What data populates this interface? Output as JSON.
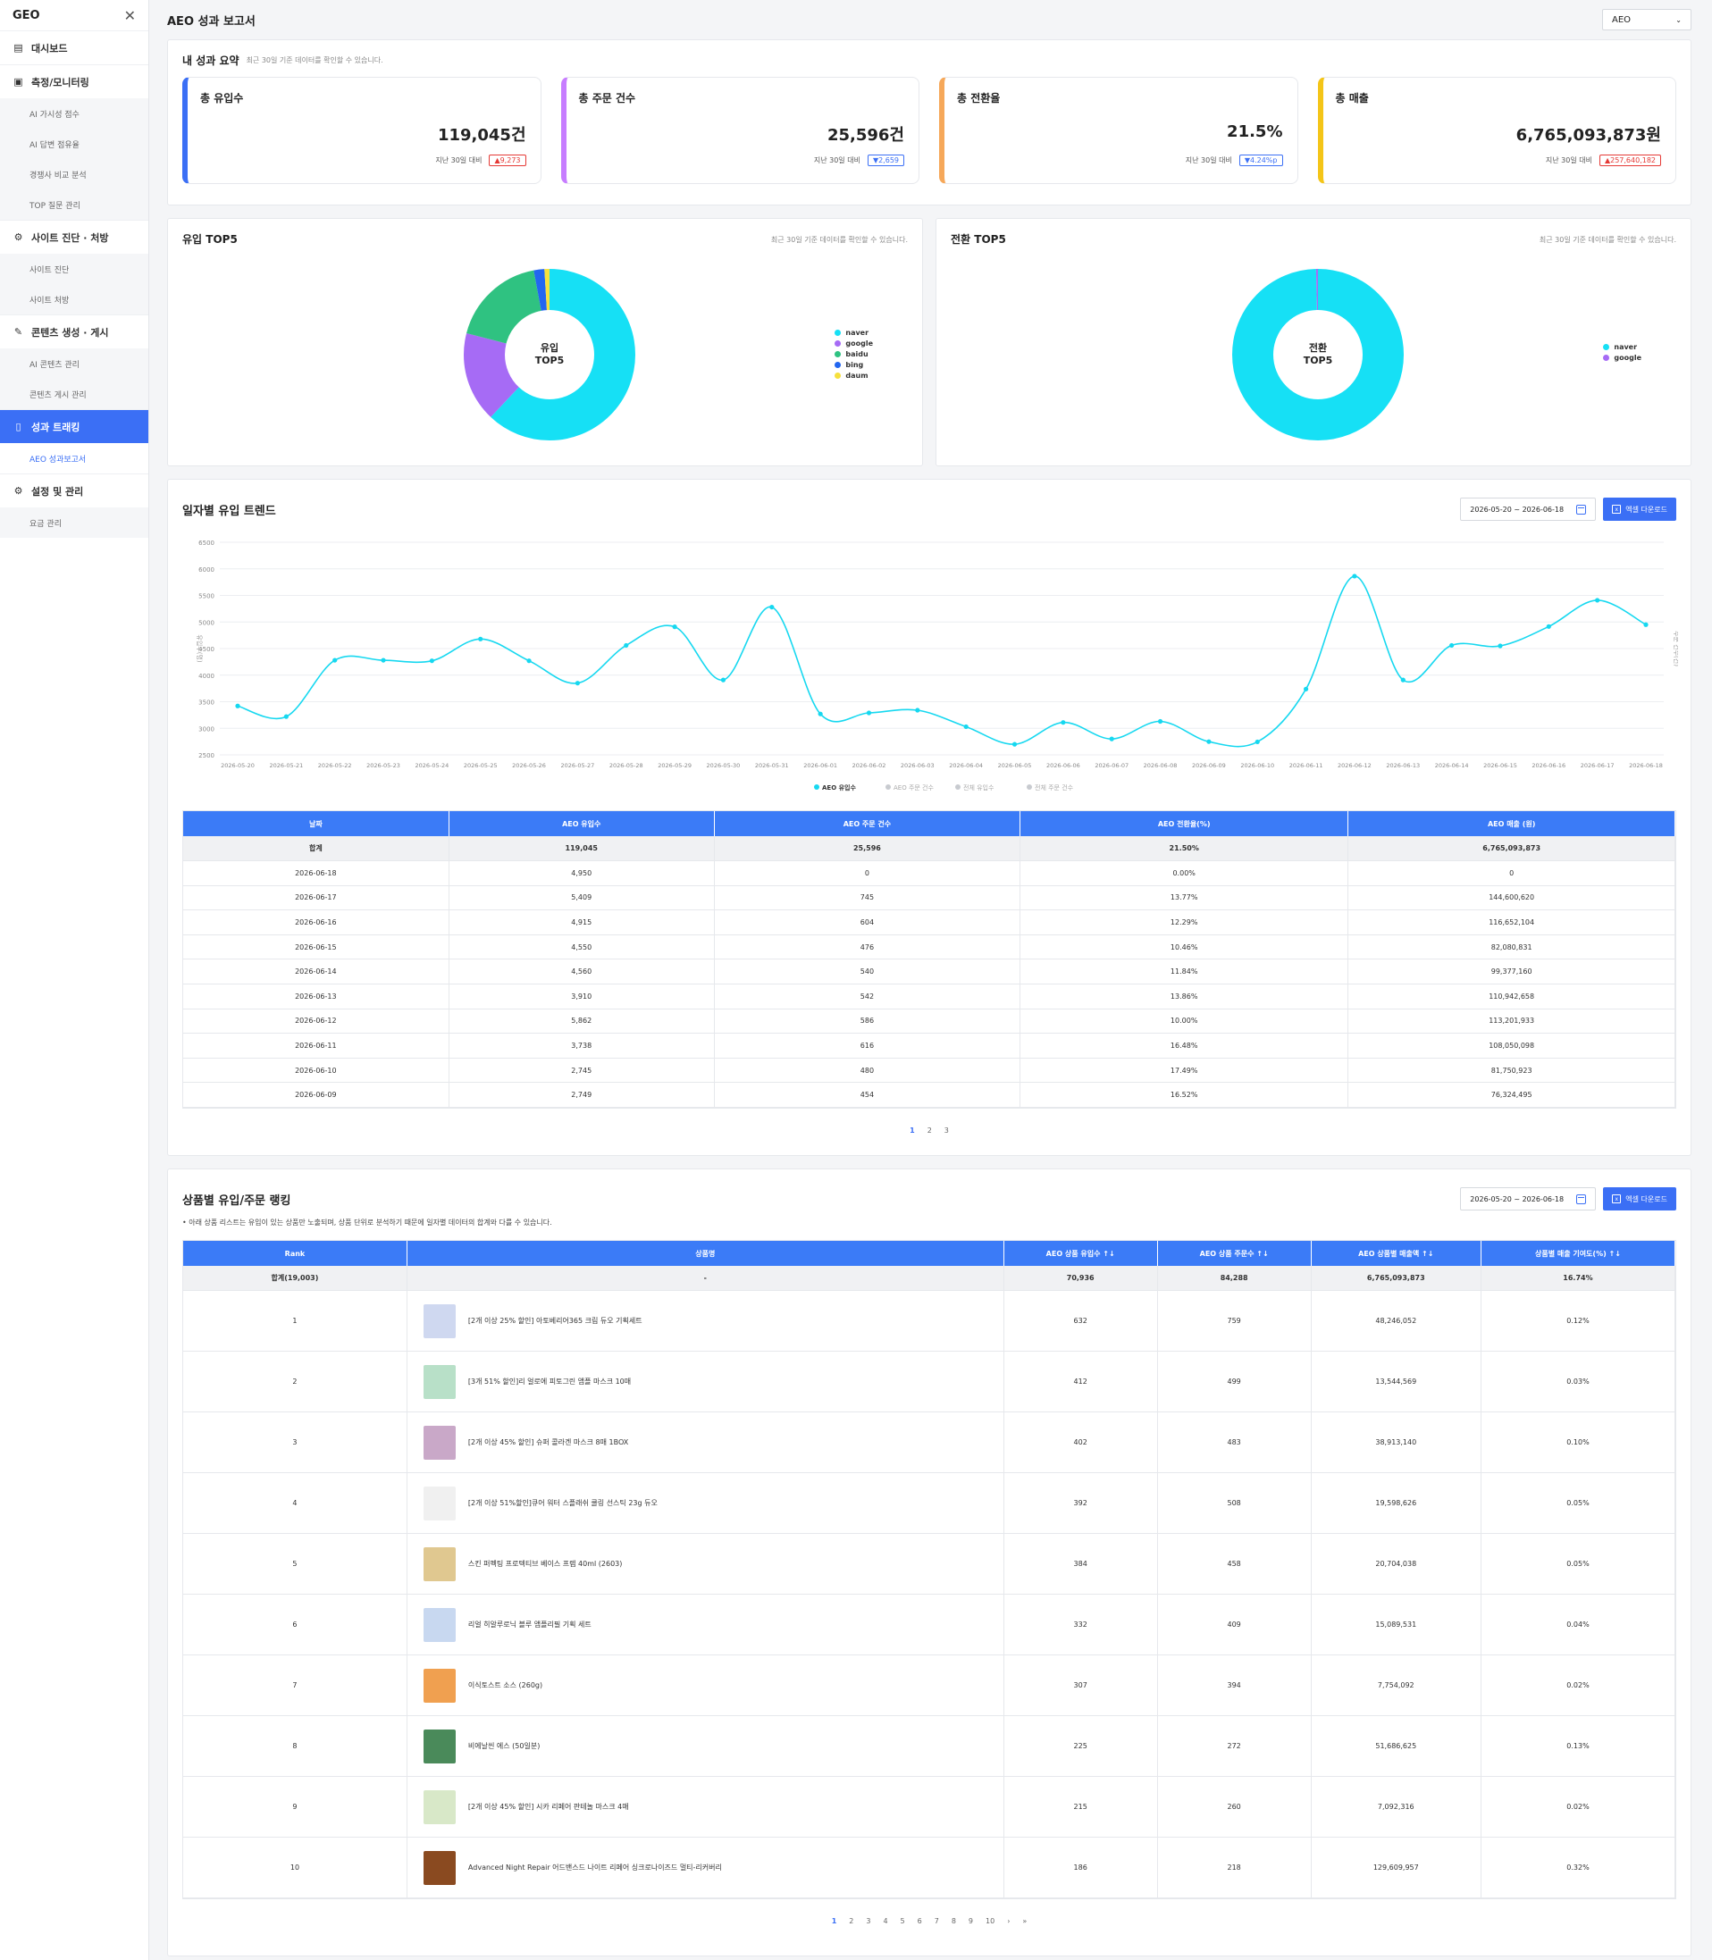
{
  "sidebar": {
    "logo": "GEO",
    "close_icon": "✕",
    "items": [
      {
        "type": "sec",
        "label": "대시보드",
        "icon": "chart-icon"
      },
      {
        "type": "sec",
        "label": "측정/모니터링",
        "icon": "monitor-icon"
      },
      {
        "type": "sub",
        "label": "AI 가시성 점수"
      },
      {
        "type": "sub",
        "label": "AI 답변 점유율"
      },
      {
        "type": "sub",
        "label": "경쟁사 비교 분석"
      },
      {
        "type": "sub",
        "label": "TOP 질문 관리"
      },
      {
        "type": "sec",
        "label": "사이트 진단 · 처방",
        "icon": "gear-icon"
      },
      {
        "type": "sub",
        "label": "사이트 진단"
      },
      {
        "type": "sub",
        "label": "사이트 처방"
      },
      {
        "type": "sec",
        "label": "콘텐츠 생성 · 게시",
        "icon": "edit-icon"
      },
      {
        "type": "sub",
        "label": "AI 콘텐츠 관리"
      },
      {
        "type": "sub",
        "label": "콘텐츠 게시 관리"
      },
      {
        "type": "sec",
        "label": "성과 트래킹",
        "icon": "document-icon",
        "active": true
      },
      {
        "type": "sub",
        "label": "AEO 성과보고서",
        "active": true
      },
      {
        "type": "sec",
        "label": "설정 및 관리",
        "icon": "settings-icon"
      },
      {
        "type": "sub",
        "label": "요금 관리"
      }
    ]
  },
  "header": {
    "title": "AEO 성과 보고서",
    "select_value": "AEO"
  },
  "summary": {
    "title": "내 성과 요약",
    "subtitle": "최근 30일 기준 데이터를 확인할 수 있습니다.",
    "cards": [
      {
        "label": "총 유입수",
        "value": "119,045건",
        "cmp_label": "지난 30일 대비",
        "delta": "▲9,273",
        "dir": "up",
        "color": "#3b6ff5"
      },
      {
        "label": "총 주문 건수",
        "value": "25,596건",
        "cmp_label": "지난 30일 대비",
        "delta": "▼2,659",
        "dir": "down",
        "color": "#c77dff"
      },
      {
        "label": "총 전환율",
        "value": "21.5%",
        "cmp_label": "지난 30일 대비",
        "delta": "▼4.24%p",
        "dir": "down",
        "color": "#f6a85a"
      },
      {
        "label": "총 매출",
        "value": "6,765,093,873원",
        "cmp_label": "지난 30일 대비",
        "delta": "▲257,640,182",
        "dir": "up",
        "color": "#f4c518"
      }
    ]
  },
  "donuts": [
    {
      "title": "유입 TOP5",
      "note": "최근 30일 기준 데이터를 확인할 수 있습니다.",
      "center": [
        "유입",
        "TOP5"
      ],
      "slices": [
        {
          "name": "naver",
          "value": 62,
          "color": "#16e0f5"
        },
        {
          "name": "google",
          "value": 17,
          "color": "#a66bf5"
        },
        {
          "name": "baidu",
          "value": 18,
          "color": "#2fc281"
        },
        {
          "name": "bing",
          "value": 2,
          "color": "#2266f0"
        },
        {
          "name": "daum",
          "value": 1,
          "color": "#f6e03c"
        }
      ]
    },
    {
      "title": "전환 TOP5",
      "note": "최근 30일 기준 데이터를 확인할 수 있습니다.",
      "center": [
        "전환",
        "TOP5"
      ],
      "slices": [
        {
          "name": "naver",
          "value": 99.6,
          "color": "#16e0f5"
        },
        {
          "name": "google",
          "value": 0.4,
          "color": "#a66bf5"
        }
      ]
    }
  ],
  "trend": {
    "title": "일자별 유입 트렌드",
    "date_range": "2026-05-20 ~ 2026-06-18",
    "excel_label": "엑셀 다운로드",
    "y_left_label": "유입수(명)",
    "y_right_label": "주문 건수(건)",
    "legend": [
      "AEO 유입수",
      "AEO 주문 건수",
      "전체 유입수",
      "전체 주문 건수"
    ],
    "columns": [
      "날짜",
      "AEO 유입수",
      "AEO 주문 건수",
      "AEO 전환율(%)",
      "AEO 매출 (원)"
    ],
    "total": [
      "합계",
      "119,045",
      "25,596",
      "21.50%",
      "6,765,093,873"
    ],
    "rows": [
      [
        "2026-06-18",
        "4,950",
        "0",
        "0.00%",
        "0"
      ],
      [
        "2026-06-17",
        "5,409",
        "745",
        "13.77%",
        "144,600,620"
      ],
      [
        "2026-06-16",
        "4,915",
        "604",
        "12.29%",
        "116,652,104"
      ],
      [
        "2026-06-15",
        "4,550",
        "476",
        "10.46%",
        "82,080,831"
      ],
      [
        "2026-06-14",
        "4,560",
        "540",
        "11.84%",
        "99,377,160"
      ],
      [
        "2026-06-13",
        "3,910",
        "542",
        "13.86%",
        "110,942,658"
      ],
      [
        "2026-06-12",
        "5,862",
        "586",
        "10.00%",
        "113,201,933"
      ],
      [
        "2026-06-11",
        "3,738",
        "616",
        "16.48%",
        "108,050,098"
      ],
      [
        "2026-06-10",
        "2,745",
        "480",
        "17.49%",
        "81,750,923"
      ],
      [
        "2026-06-09",
        "2,749",
        "454",
        "16.52%",
        "76,324,495"
      ]
    ],
    "pages": [
      "1",
      "2",
      "3"
    ]
  },
  "chart_data": {
    "type": "line",
    "x": [
      "2026-05-20",
      "2026-05-21",
      "2026-05-22",
      "2026-05-23",
      "2026-05-24",
      "2026-05-25",
      "2026-05-26",
      "2026-05-27",
      "2026-05-28",
      "2026-05-29",
      "2026-05-30",
      "2026-05-31",
      "2026-06-01",
      "2026-06-02",
      "2026-06-03",
      "2026-06-04",
      "2026-06-05",
      "2026-06-06",
      "2026-06-07",
      "2026-06-08",
      "2026-06-09",
      "2026-06-10",
      "2026-06-11",
      "2026-06-12",
      "2026-06-13",
      "2026-06-14",
      "2026-06-15",
      "2026-06-16",
      "2026-06-17",
      "2026-06-18"
    ],
    "series": [
      {
        "name": "AEO 유입수",
        "color": "#16d8f0",
        "values": [
          3420,
          3220,
          4280,
          4280,
          4270,
          4680,
          4270,
          3850,
          4560,
          4910,
          3910,
          5280,
          3270,
          3290,
          3340,
          3030,
          2700,
          3110,
          2800,
          3130,
          2749,
          2745,
          3738,
          5862,
          3910,
          4560,
          4550,
          4915,
          5409,
          4950
        ]
      }
    ],
    "ylim": [
      2500,
      6500
    ],
    "yticks": [
      2500,
      3000,
      3500,
      4000,
      4500,
      5000,
      5500,
      6000,
      6500
    ],
    "ylabel": "유입수(명)"
  },
  "ranking": {
    "title": "상품별 유입/주문 랭킹",
    "date_range": "2026-05-20 ~ 2026-06-18",
    "excel_label": "엑셀 다운로드",
    "desc": "• 아래 상품 리스트는 유입이 있는 상품만 노출되며, 상품 단위로 분석하기 때문에 일자별 데이터의 합계와 다를 수 있습니다.",
    "columns": [
      "Rank",
      "상품명",
      "AEO 상품 유입수 ↑↓",
      "AEO 상품 주문수 ↑↓",
      "AEO 상품별 매출액 ↑↓",
      "상품별 매출 기여도(%) ↑↓"
    ],
    "total": [
      "합계(19,003)",
      "-",
      "70,936",
      "84,288",
      "6,765,093,873",
      "16.74%"
    ],
    "rows": [
      {
        "rank": "1",
        "name": "[2개 이상 25% 할인] 아토베리어365 크림 듀오 기획세트",
        "inflow": "632",
        "orders": "759",
        "sales": "48,246,052",
        "share": "0.12%",
        "thumb": "#cfd8f0"
      },
      {
        "rank": "2",
        "name": "[3개 51% 할인]리 얼로에 피토그린 앰플 마스크 10매",
        "inflow": "412",
        "orders": "499",
        "sales": "13,544,569",
        "share": "0.03%",
        "thumb": "#b8e0c8"
      },
      {
        "rank": "3",
        "name": "[2개 이상 45% 할인] 슈퍼 콜라겐 마스크 8매 1BOX",
        "inflow": "402",
        "orders": "483",
        "sales": "38,913,140",
        "share": "0.10%",
        "thumb": "#c9a8c8"
      },
      {
        "rank": "4",
        "name": "[2개 이상 51%할인]큐어 워터 스플래쉬 쿨링 선스틱 23g 듀오",
        "inflow": "392",
        "orders": "508",
        "sales": "19,598,626",
        "share": "0.05%",
        "thumb": "#f0f0f0"
      },
      {
        "rank": "5",
        "name": "스킨 퍼펙팅 프로텍티브 베이스 프렙 40ml (2603)",
        "inflow": "384",
        "orders": "458",
        "sales": "20,704,038",
        "share": "0.05%",
        "thumb": "#e0c890"
      },
      {
        "rank": "6",
        "name": "리얼 히알루로닉 블루 앰플리필 기획 세트",
        "inflow": "332",
        "orders": "409",
        "sales": "15,089,531",
        "share": "0.04%",
        "thumb": "#c8d8f0"
      },
      {
        "rank": "7",
        "name": "이식토스트 소스 (260g)",
        "inflow": "307",
        "orders": "394",
        "sales": "7,754,092",
        "share": "0.02%",
        "thumb": "#f0a050"
      },
      {
        "rank": "8",
        "name": "비에날씬 에스 (50일분)",
        "inflow": "225",
        "orders": "272",
        "sales": "51,686,625",
        "share": "0.13%",
        "thumb": "#4a8a5a"
      },
      {
        "rank": "9",
        "name": "[2개 이상 45% 할인] 시카 리페어 판테놀 마스크 4매",
        "inflow": "215",
        "orders": "260",
        "sales": "7,092,316",
        "share": "0.02%",
        "thumb": "#d8e8c8"
      },
      {
        "rank": "10",
        "name": "Advanced Night Repair 어드밴스드 나이트 리페어 싱크로나이즈드 멀티-리커버리",
        "inflow": "186",
        "orders": "218",
        "sales": "129,609,957",
        "share": "0.32%",
        "thumb": "#8a4a20"
      }
    ],
    "pages": [
      "1",
      "2",
      "3",
      "4",
      "5",
      "6",
      "7",
      "8",
      "9",
      "10",
      "›",
      "»"
    ]
  }
}
